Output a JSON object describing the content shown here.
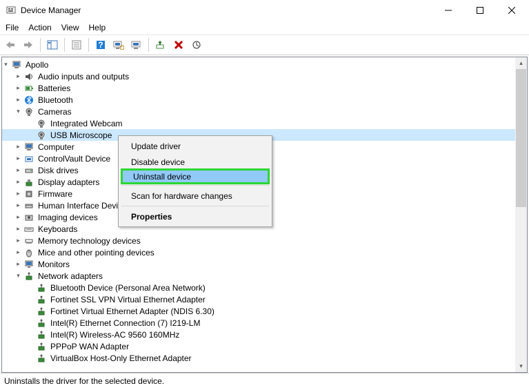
{
  "window": {
    "title": "Device Manager",
    "minimize": "Minimize",
    "maximize": "Maximize",
    "close": "Close"
  },
  "menu": {
    "file": "File",
    "action": "Action",
    "view": "View",
    "help": "Help"
  },
  "toolbar": {
    "back": "Back",
    "forward": "Forward",
    "showhide": "Show/Hide Console Tree",
    "properties": "Properties",
    "help": "Help",
    "updatehw": "Scan for hardware changes",
    "monitor": "Update driver",
    "addhw": "Add legacy hardware",
    "uninstall": "Uninstall device",
    "refresh": "Refresh"
  },
  "tree": {
    "root": "Apollo",
    "audio": "Audio inputs and outputs",
    "batteries": "Batteries",
    "bluetooth": "Bluetooth",
    "cameras": "Cameras",
    "integrated_webcam": "Integrated Webcam",
    "usb_microscope": "USB Microscope",
    "computer": "Computer",
    "controlvault": "ControlVault Device",
    "diskdrives": "Disk drives",
    "display": "Display adapters",
    "firmware": "Firmware",
    "hid": "Human Interface Devices",
    "imaging": "Imaging devices",
    "keyboards": "Keyboards",
    "memtech": "Memory technology devices",
    "mice": "Mice and other pointing devices",
    "monitors": "Monitors",
    "network": "Network adapters",
    "net_bt": "Bluetooth Device (Personal Area Network)",
    "net_fortissl": "Fortinet SSL VPN Virtual Ethernet Adapter",
    "net_forti": "Fortinet Virtual Ethernet Adapter (NDIS 6.30)",
    "net_ieth": "Intel(R) Ethernet Connection (7) I219-LM",
    "net_iwifi": "Intel(R) Wireless-AC 9560 160MHz",
    "net_pppop": "PPPoP WAN Adapter",
    "net_vbox": "VirtualBox Host-Only Ethernet Adapter"
  },
  "contextmenu": {
    "update": "Update driver",
    "disable": "Disable device",
    "uninstall": "Uninstall device",
    "scan": "Scan for hardware changes",
    "properties": "Properties"
  },
  "statusbar": {
    "text": "Uninstalls the driver for the selected device."
  }
}
